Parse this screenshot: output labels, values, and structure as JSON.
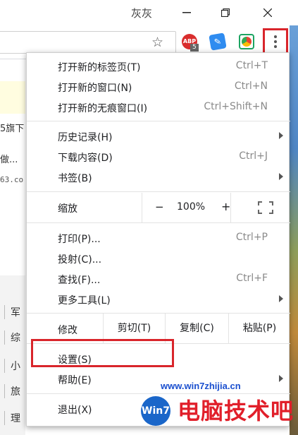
{
  "window": {
    "title": "灰灰"
  },
  "toolbar": {
    "abp_label": "ABP",
    "abp_count": "5",
    "star_glyph": "☆"
  },
  "page": {
    "snippets": [
      "5旗下",
      "做...",
      "63.co"
    ],
    "side_items": [
      "军",
      "综",
      "小",
      "旅",
      "理"
    ]
  },
  "menu": {
    "new_tab": {
      "label": "打开新的标签页(T)",
      "shortcut": "Ctrl+T"
    },
    "new_window": {
      "label": "打开新的窗口(N)",
      "shortcut": "Ctrl+N"
    },
    "incognito": {
      "label": "打开新的无痕窗口(I)",
      "shortcut": "Ctrl+Shift+N"
    },
    "history": {
      "label": "历史记录(H)"
    },
    "downloads": {
      "label": "下载内容(D)",
      "shortcut": "Ctrl+J"
    },
    "bookmarks": {
      "label": "书签(B)"
    },
    "zoom": {
      "label": "缩放",
      "minus": "−",
      "value": "100%",
      "plus": "+"
    },
    "print": {
      "label": "打印(P)...",
      "shortcut": "Ctrl+P"
    },
    "cast": {
      "label": "投射(C)..."
    },
    "find": {
      "label": "查找(F)...",
      "shortcut": "Ctrl+F"
    },
    "more_tools": {
      "label": "更多工具(L)"
    },
    "edit": {
      "label": "修改",
      "cut": "剪切(T)",
      "copy": "复制(C)",
      "paste": "粘贴(P)"
    },
    "settings": {
      "label": "设置(S)"
    },
    "help": {
      "label": "帮助(E)"
    },
    "exit": {
      "label": "退出(X)"
    }
  },
  "watermark": {
    "url": "www.win7zhijia.cn",
    "logo": "Win7",
    "big_text": "电脑技术吧"
  },
  "colors": {
    "highlight_box": "#d9252b",
    "menu_bg": "#ffffff",
    "shortcut_text": "#8a8a8a"
  }
}
